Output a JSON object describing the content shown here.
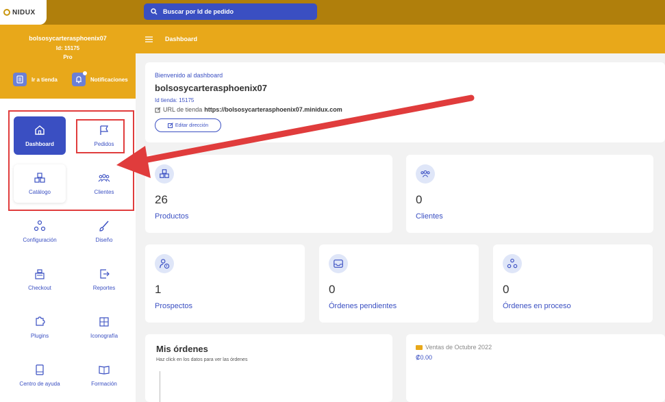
{
  "brand": {
    "logo_text": "NIDUX"
  },
  "search": {
    "placeholder": "Buscar por Id de pedido"
  },
  "store": {
    "name": "bolsosycarterasphoenix07",
    "id_label": "Id: 15175",
    "plan": "Pro"
  },
  "top_actions": {
    "store_label": "Ir a tienda",
    "notifications_label": "Notificaciones"
  },
  "nav": {
    "items": [
      {
        "label": "Dashboard",
        "icon": "home-icon"
      },
      {
        "label": "Pedidos",
        "icon": "flag-icon"
      },
      {
        "label": "Catálogo",
        "icon": "boxes-icon"
      },
      {
        "label": "Clientes",
        "icon": "users-icon"
      },
      {
        "label": "Configuración",
        "icon": "nodes-icon"
      },
      {
        "label": "Diseño",
        "icon": "brush-icon"
      },
      {
        "label": "Checkout",
        "icon": "register-icon"
      },
      {
        "label": "Reportes",
        "icon": "export-icon"
      },
      {
        "label": "Plugins",
        "icon": "puzzle-icon"
      },
      {
        "label": "Iconografía",
        "icon": "grid-icon"
      },
      {
        "label": "Centro de ayuda",
        "icon": "book-icon"
      },
      {
        "label": "Formación",
        "icon": "open-book-icon"
      }
    ]
  },
  "header": {
    "title": "Dashboard"
  },
  "welcome": {
    "subtitle": "Bienvenido al dashboard",
    "store_name": "bolsosycarterasphoenix07",
    "store_id": "Id tienda: 15175",
    "url_label": "URL de tienda",
    "url_value": "https://bolsosycarterasphoenix07.minidux.com",
    "edit_button": "Editar dirección"
  },
  "stats": [
    {
      "value": "26",
      "label": "Productos"
    },
    {
      "value": "0",
      "label": "Clientes"
    },
    {
      "value": "1",
      "label": "Prospectos"
    },
    {
      "value": "0",
      "label": "Órdenes pendientes"
    },
    {
      "value": "0",
      "label": "Órdenes en proceso"
    }
  ],
  "orders": {
    "title": "Mis órdenes",
    "subtitle": "Haz click en los datos para ver las órdenes"
  },
  "sales": {
    "title": "Ventas de Octubre 2022",
    "value": "₡0.00"
  },
  "colors": {
    "primary": "#3a4fc2",
    "accent": "#e8a81a",
    "annotation": "#e03c3c"
  }
}
